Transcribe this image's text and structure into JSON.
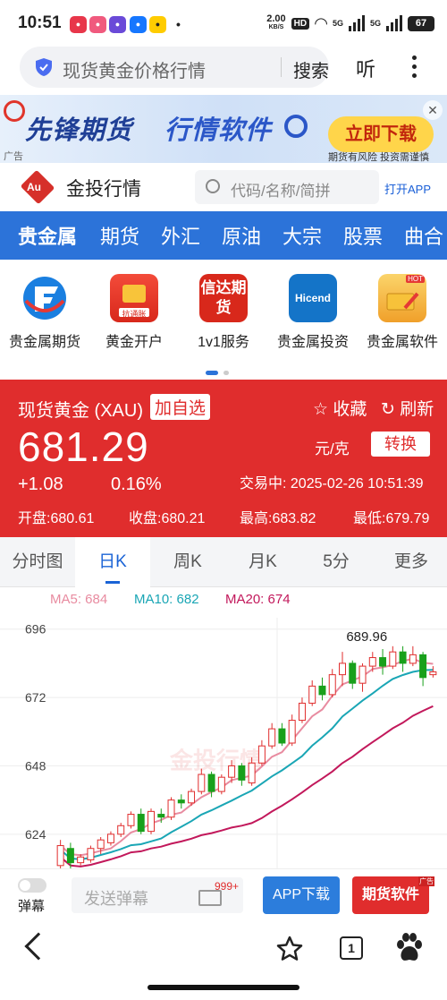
{
  "status_bar": {
    "time": "10:51",
    "net_speed": "2.00",
    "net_unit": "KB/S",
    "hd": "HD",
    "sig1": "5G",
    "sig2": "5G",
    "battery": "67"
  },
  "browser": {
    "address_text": "现货黄金价格行情",
    "search_label": "搜索",
    "listen_label": "听"
  },
  "ad_banner": {
    "headline_1": "先锋期货",
    "headline_2": "行情软件",
    "download_label": "立即下载",
    "ad_tag": "广告",
    "risk_notice": "期货有风险 投资需谨慎",
    "brand_color": "#1f3f96"
  },
  "site_header": {
    "site_name": "金投行情",
    "logo_text": "Au",
    "search_placeholder": "代码/名称/简拼",
    "open_app_label": "打开APP"
  },
  "category_nav": {
    "items": [
      "贵金属",
      "期货",
      "外汇",
      "原油",
      "大宗",
      "股票",
      "曲合"
    ]
  },
  "shortcuts": {
    "items": [
      {
        "label": "贵金属期货",
        "icon": "futures-logo-icon"
      },
      {
        "label": "黄金开户",
        "icon": "gold-bar-icon",
        "sub": "抗通胀"
      },
      {
        "label": "1v1服务",
        "icon": "xinda-futures-icon",
        "sub": "信达期货"
      },
      {
        "label": "贵金属投资",
        "icon": "hicend-icon",
        "sub": "Hicend"
      },
      {
        "label": "贵金属软件",
        "icon": "gold-software-icon",
        "sub": "HOT"
      }
    ],
    "ad_tag": "广告"
  },
  "quote": {
    "name": "现货黄金 (XAU)",
    "add_watch": "加自选",
    "favorite": "收藏",
    "refresh": "刷新",
    "price": "681.29",
    "unit": "元/克",
    "convert": "转换",
    "change": "+1.08",
    "change_pct": "0.16%",
    "timestamp": "交易中: 2025-02-26 10:51:39",
    "open": "开盘:680.61",
    "close": "收盘:680.21",
    "high": "最高:683.82",
    "low": "最低:679.79",
    "bg_color": "#e02d2d"
  },
  "period_tabs": {
    "items": [
      "分时图",
      "日K",
      "周K",
      "月K",
      "5分",
      "更多"
    ],
    "active_index": 1
  },
  "chart_data": {
    "type": "candlestick",
    "ma_labels": [
      "MA5: 684",
      "MA10: 682",
      "MA20: 674"
    ],
    "ma_colors": [
      "#e88ba0",
      "#1aa6b5",
      "#c2185b"
    ],
    "y_ticks": [
      696,
      672,
      648,
      624
    ],
    "ylim": [
      612,
      700
    ],
    "max_label": "689.96",
    "up_color": "#e02d2d",
    "down_color": "#19a01b",
    "watermark": "金投行情",
    "candles": [
      {
        "o": 613,
        "c": 620,
        "h": 622,
        "l": 612
      },
      {
        "o": 619,
        "c": 614,
        "h": 621,
        "l": 612
      },
      {
        "o": 614,
        "c": 616,
        "h": 617,
        "l": 613
      },
      {
        "o": 615,
        "c": 619,
        "h": 620,
        "l": 614
      },
      {
        "o": 619,
        "c": 622,
        "h": 623,
        "l": 617
      },
      {
        "o": 621,
        "c": 624,
        "h": 625,
        "l": 620
      },
      {
        "o": 624,
        "c": 627,
        "h": 628,
        "l": 623
      },
      {
        "o": 627,
        "c": 631,
        "h": 632,
        "l": 626
      },
      {
        "o": 631,
        "c": 625,
        "h": 633,
        "l": 624
      },
      {
        "o": 625,
        "c": 632,
        "h": 633,
        "l": 624
      },
      {
        "o": 631,
        "c": 630,
        "h": 633,
        "l": 628
      },
      {
        "o": 630,
        "c": 636,
        "h": 637,
        "l": 629
      },
      {
        "o": 636,
        "c": 635,
        "h": 638,
        "l": 633
      },
      {
        "o": 635,
        "c": 639,
        "h": 640,
        "l": 634
      },
      {
        "o": 639,
        "c": 645,
        "h": 647,
        "l": 638
      },
      {
        "o": 645,
        "c": 639,
        "h": 646,
        "l": 637
      },
      {
        "o": 639,
        "c": 644,
        "h": 645,
        "l": 638
      },
      {
        "o": 644,
        "c": 648,
        "h": 650,
        "l": 642
      },
      {
        "o": 648,
        "c": 643,
        "h": 649,
        "l": 641
      },
      {
        "o": 642,
        "c": 649,
        "h": 651,
        "l": 641
      },
      {
        "o": 649,
        "c": 655,
        "h": 657,
        "l": 648
      },
      {
        "o": 655,
        "c": 661,
        "h": 663,
        "l": 654
      },
      {
        "o": 661,
        "c": 656,
        "h": 663,
        "l": 655
      },
      {
        "o": 656,
        "c": 664,
        "h": 666,
        "l": 655
      },
      {
        "o": 664,
        "c": 670,
        "h": 672,
        "l": 663
      },
      {
        "o": 670,
        "c": 676,
        "h": 678,
        "l": 669
      },
      {
        "o": 676,
        "c": 673,
        "h": 679,
        "l": 671
      },
      {
        "o": 673,
        "c": 680,
        "h": 682,
        "l": 672
      },
      {
        "o": 680,
        "c": 684,
        "h": 688,
        "l": 676
      },
      {
        "o": 684,
        "c": 677,
        "h": 685,
        "l": 675
      },
      {
        "o": 677,
        "c": 683,
        "h": 684,
        "l": 674
      },
      {
        "o": 683,
        "c": 686,
        "h": 688,
        "l": 681
      },
      {
        "o": 686,
        "c": 683,
        "h": 689,
        "l": 680
      },
      {
        "o": 683,
        "c": 688,
        "h": 690,
        "l": 682
      },
      {
        "o": 688,
        "c": 684,
        "h": 690,
        "l": 681
      },
      {
        "o": 684,
        "c": 687,
        "h": 690,
        "l": 683
      },
      {
        "o": 687,
        "c": 679,
        "h": 688,
        "l": 676
      },
      {
        "o": 680,
        "c": 681,
        "h": 683,
        "l": 679
      }
    ]
  },
  "action_bar": {
    "danmu_label": "弹幕",
    "send_placeholder": "发送弹幕",
    "badge": "999+",
    "app_download": "APP下载",
    "futures_software": "期货软件",
    "ad_tag": "广告"
  },
  "bottom_nav": {
    "tab_count": "1"
  }
}
